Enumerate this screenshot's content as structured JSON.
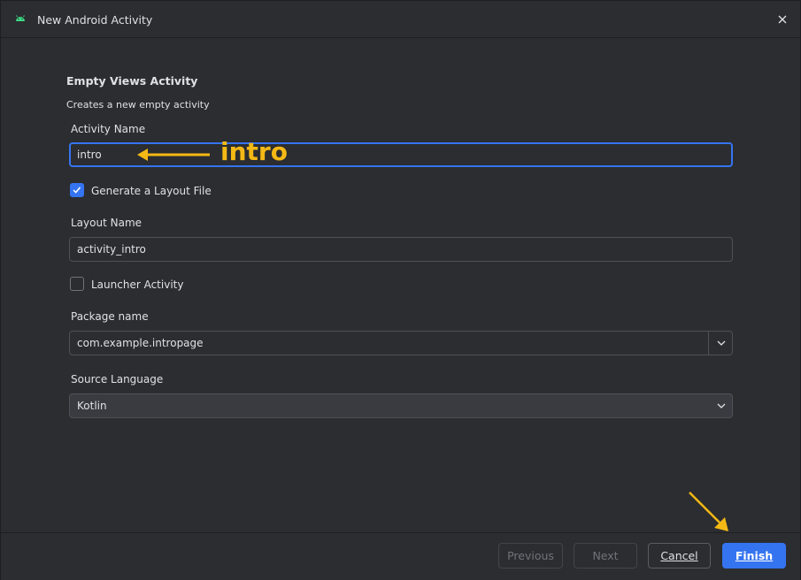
{
  "window": {
    "title": "New Android Activity",
    "icon": "android-icon",
    "close_icon": "close-icon"
  },
  "header": {
    "heading": "Empty Views Activity",
    "subheading": "Creates a new empty activity"
  },
  "form": {
    "activity_name": {
      "label": "Activity Name",
      "value": "intro"
    },
    "generate_layout": {
      "label": "Generate a Layout File",
      "checked": true
    },
    "layout_name": {
      "label": "Layout Name",
      "value": "activity_intro"
    },
    "launcher_activity": {
      "label": "Launcher Activity",
      "checked": false
    },
    "package_name": {
      "label": "Package name",
      "value": "com.example.intropage"
    },
    "source_language": {
      "label": "Source Language",
      "value": "Kotlin"
    }
  },
  "annotation": {
    "text": "intro",
    "color": "#f5b915"
  },
  "footer": {
    "previous": "Previous",
    "next": "Next",
    "cancel": "Cancel",
    "finish": "Finish"
  },
  "colors": {
    "background": "#2b2d30",
    "accent": "#3574f0",
    "text": "#dfe1e5"
  }
}
